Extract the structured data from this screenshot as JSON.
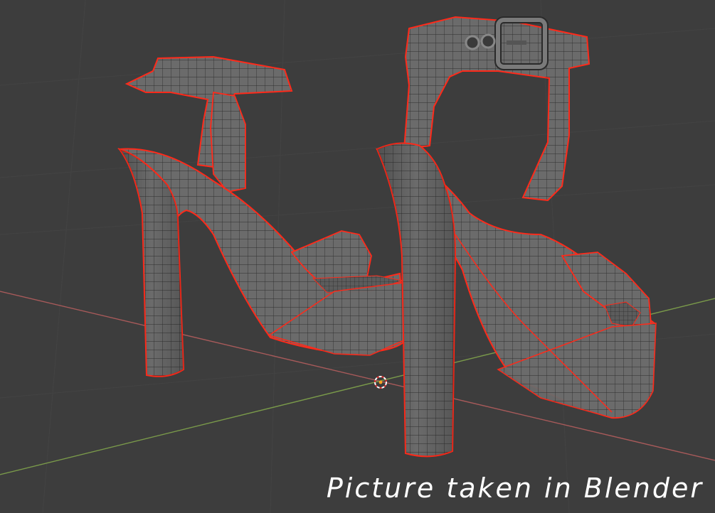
{
  "viewport": {
    "background_color": "#3d3d3d",
    "grid_color": "#454545",
    "x_axis_color": "#a85a5a",
    "y_axis_color": "#7a9a4a"
  },
  "model": {
    "mesh_color": "#6b6b6b",
    "wire_color": "#2a2a2a",
    "selected_edge_color": "#ff2a1a"
  },
  "origin_cursor": {
    "icon": "3d-cursor-icon",
    "ring_color": "#ffffff",
    "dash_color": "#e03030",
    "dot_color": "#ffa020"
  },
  "caption": {
    "text": "Picture taken in Blender"
  }
}
